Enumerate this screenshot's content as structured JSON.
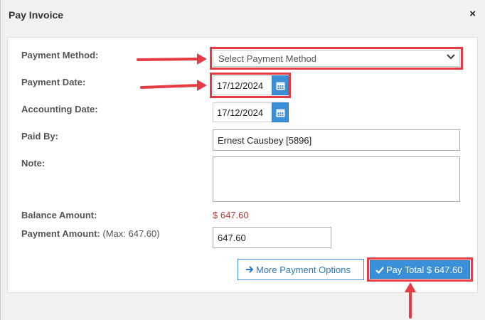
{
  "dialog": {
    "title": "Pay Invoice",
    "close_icon": "close-icon",
    "close_glyph": "×"
  },
  "form": {
    "payment_method_label": "Payment Method:",
    "payment_method_placeholder": "Select Payment Method",
    "payment_date_label": "Payment Date:",
    "payment_date_value": "17/12/2024",
    "accounting_date_label": "Accounting Date:",
    "accounting_date_value": "17/12/2024",
    "paid_by_label": "Paid By:",
    "paid_by_value": "Ernest Causbey [5896]",
    "note_label": "Note:",
    "note_value": "",
    "balance_label": "Balance Amount:",
    "balance_value": "$ 647.60",
    "payment_amount_label": "Payment Amount:",
    "payment_amount_max": "(Max: 647.60)",
    "payment_amount_value": "647.60"
  },
  "actions": {
    "more_options_label": "More Payment Options",
    "pay_total_label": "Pay Total $ 647.60"
  },
  "colors": {
    "accent": "#3a8fd9",
    "annotation": "#e53b44",
    "balance": "#b03a3a"
  }
}
